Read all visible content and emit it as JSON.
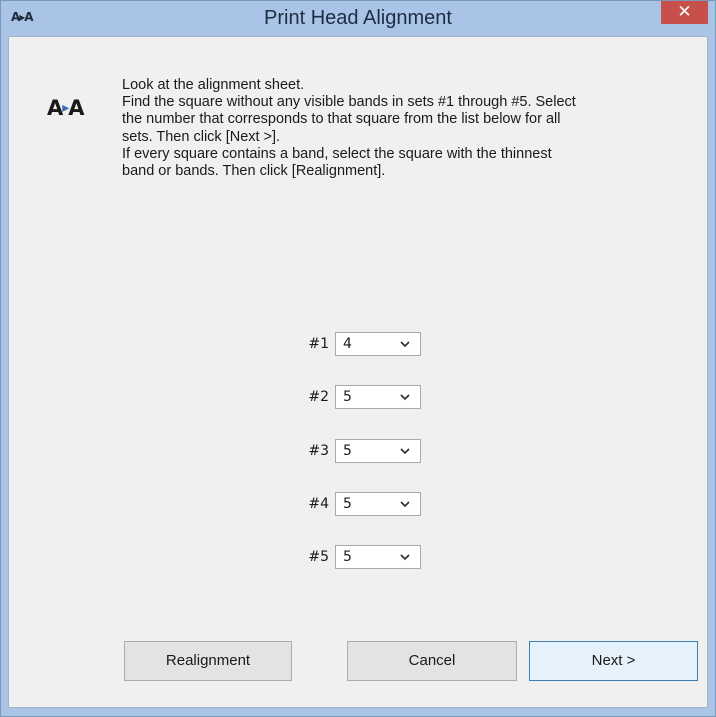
{
  "window": {
    "title": "Print Head Alignment",
    "icon_text": "A▸A",
    "close_glyph": "✕"
  },
  "logo": {
    "left": "A",
    "arrow": "▸",
    "right": "A"
  },
  "instructions": {
    "lines": [
      "Look at the alignment sheet.",
      "Find the square without any visible bands in sets #1 through #5. Select",
      "the number that corresponds to that square from the list below for all",
      "sets. Then click [Next >].",
      "If every square contains a band, select the square with the thinnest",
      "band or bands. Then click [Realignment]."
    ]
  },
  "sets": [
    {
      "label": "#1",
      "value": "4"
    },
    {
      "label": "#2",
      "value": "5"
    },
    {
      "label": "#3",
      "value": "5"
    },
    {
      "label": "#4",
      "value": "5"
    },
    {
      "label": "#5",
      "value": "5"
    }
  ],
  "buttons": {
    "realignment": "Realignment",
    "cancel": "Cancel",
    "next": "Next >"
  },
  "colors": {
    "titlebar": "#a9c4e6",
    "close_button": "#c7504a",
    "dialog_background": "#f0f0f0",
    "primary_button_border": "#3c7fb1"
  },
  "icons": {
    "app_icon": "font-adjust-icon",
    "close": "close-icon",
    "dropdown": "chevron-down-icon"
  }
}
